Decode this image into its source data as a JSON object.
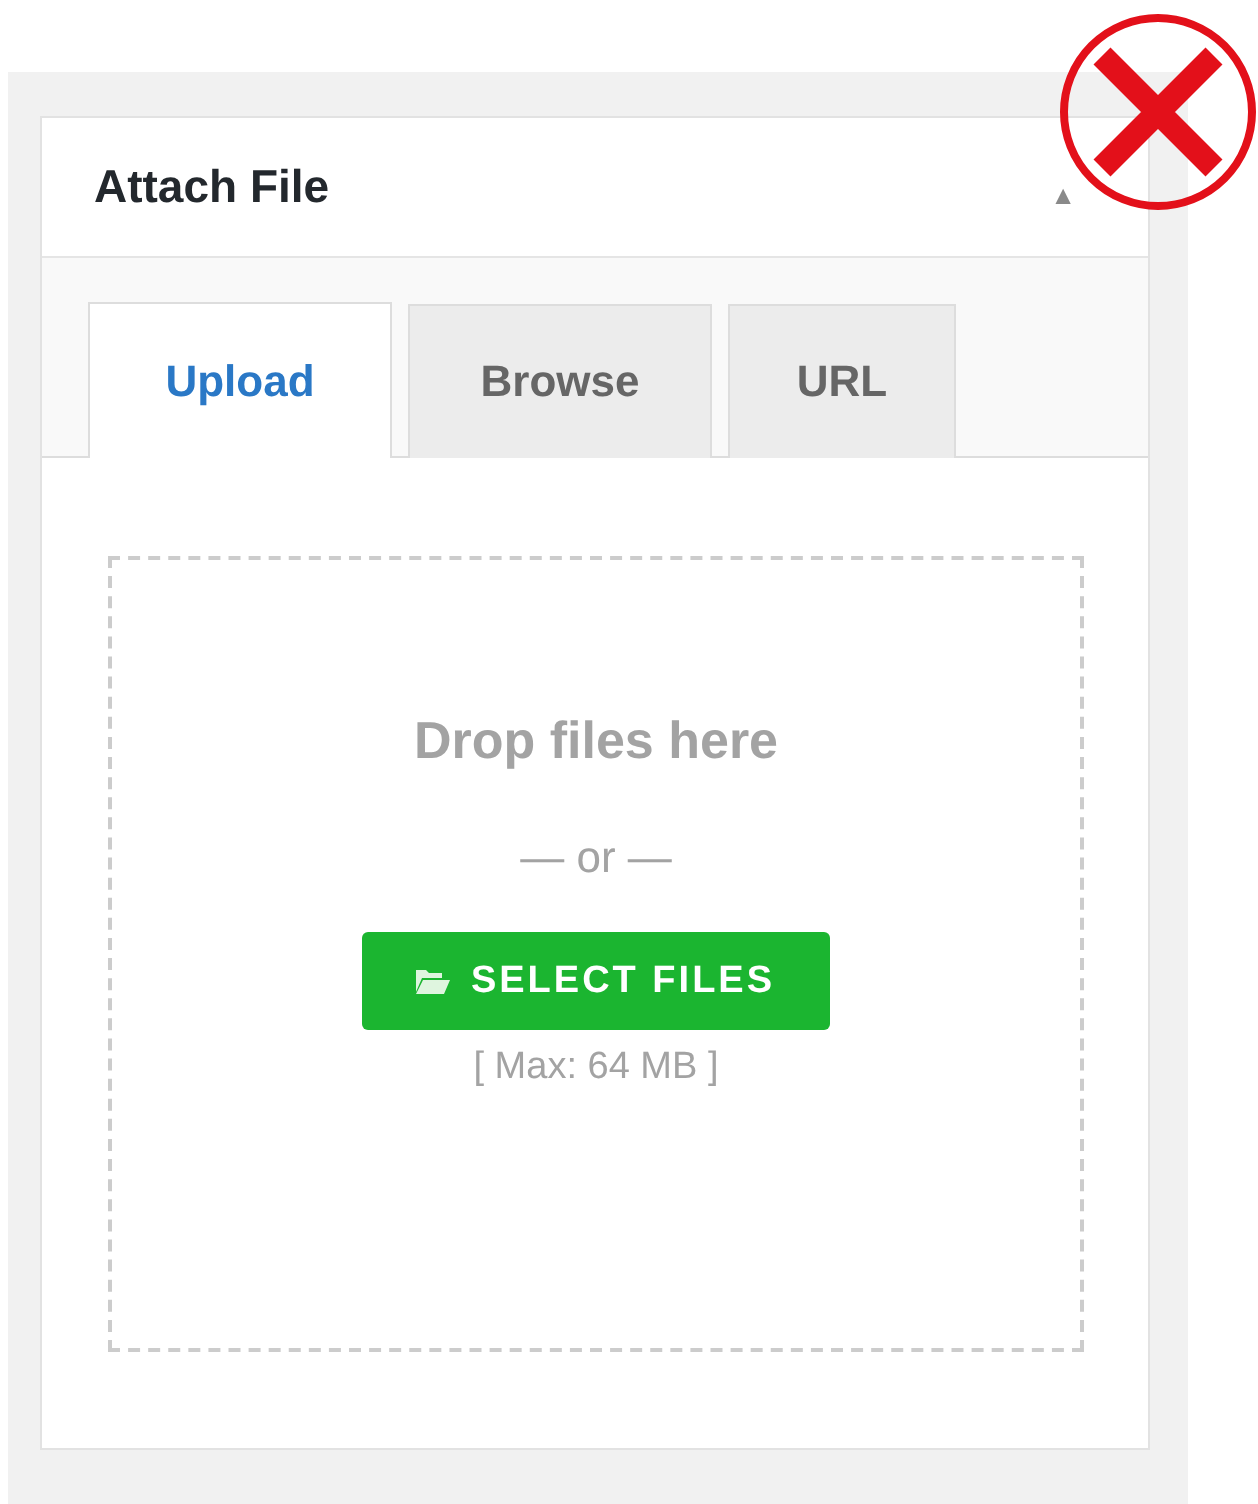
{
  "panel": {
    "title": "Attach File",
    "collapse_icon": "▲"
  },
  "tabs": [
    {
      "label": "Upload",
      "selected": true
    },
    {
      "label": "Browse",
      "selected": false
    },
    {
      "label": "URL",
      "selected": false
    }
  ],
  "dropzone": {
    "heading": "Drop files here",
    "separator": "— or —",
    "button": "SELECT FILES",
    "limit": "[ Max: 64 MB ]"
  }
}
